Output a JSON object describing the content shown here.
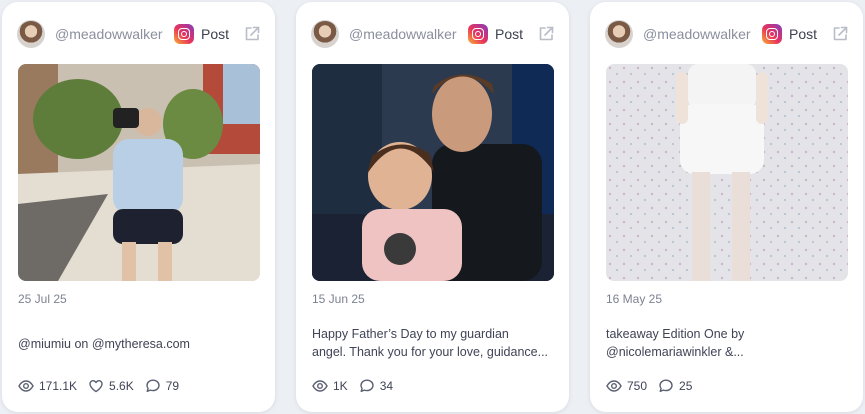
{
  "cards": [
    {
      "handle": "@meadowwalker",
      "platform_label": "Post",
      "date": "25 Jul 25",
      "caption_lines": [
        "@miumiu on @mytheresa.com"
      ],
      "views": "171.1K",
      "likes": "5.6K",
      "comments": "79"
    },
    {
      "handle": "@meadowwalker",
      "platform_label": "Post",
      "date": "15 Jun 25",
      "caption_lines": [
        "Happy Father’s Day to my guardian",
        "angel. Thank you for your love, guidance..."
      ],
      "views": "1K",
      "comments": "34"
    },
    {
      "handle": "@meadowwalker",
      "platform_label": "Post",
      "date": "16 May 25",
      "caption_lines": [
        "takeaway Edition One by",
        "@nicolemariawinkler &..."
      ],
      "views": "750",
      "comments": "25"
    }
  ],
  "icons": {
    "platform": "instagram-icon",
    "external": "external-link-icon",
    "views": "eye-icon",
    "likes": "heart-icon",
    "comments": "comment-icon"
  },
  "colors": {
    "background": "#eceff4",
    "card": "#ffffff",
    "muted_text": "#8a8f9e",
    "body_text": "#3f4456"
  }
}
